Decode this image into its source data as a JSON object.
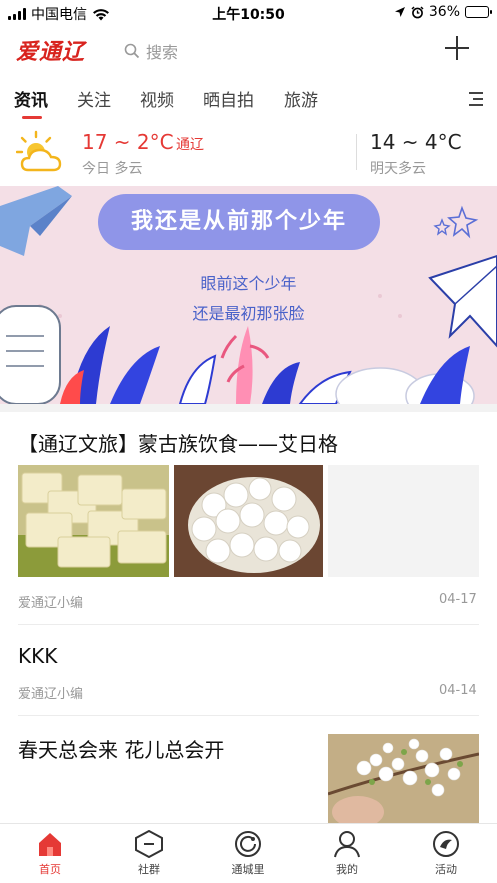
{
  "status_bar": {
    "carrier": "中国电信",
    "time": "上午10:50",
    "battery": "36%",
    "battery_level": 0.36
  },
  "header": {
    "logo": "爱通辽",
    "search_label": "搜索"
  },
  "tabs": [
    {
      "label": "资讯",
      "active": true
    },
    {
      "label": "关注"
    },
    {
      "label": "视频"
    },
    {
      "label": "晒自拍"
    },
    {
      "label": "旅游"
    }
  ],
  "weather": {
    "today_temp": "17 ~ 2°C",
    "city": "通辽",
    "today_desc": "今日 多云",
    "tomorrow_temp": "14 ~ 4°C",
    "tomorrow_desc": "明天多云"
  },
  "banner": {
    "headline": "我还是从前那个少年",
    "line1": "眼前这个少年",
    "line2": "还是最初那张脸"
  },
  "articles": [
    {
      "title": "【通辽文旅】蒙古族饮食——艾日格",
      "source": "爱通辽小编",
      "date": "04-17"
    },
    {
      "title": "KKK",
      "source": "爱通辽小编",
      "date": "04-14"
    },
    {
      "title": "春天总会来  花儿总会开"
    }
  ],
  "tabbar": [
    {
      "label": "首页",
      "icon": "home-icon",
      "active": true
    },
    {
      "label": "社群",
      "icon": "community-icon"
    },
    {
      "label": "通城里",
      "icon": "city-icon"
    },
    {
      "label": "我的",
      "icon": "profile-icon"
    },
    {
      "label": "活动",
      "icon": "activity-icon"
    }
  ],
  "colors": {
    "accent": "#e53935",
    "banner_bg": "#f4dfe6",
    "pill": "#8f95e8"
  }
}
